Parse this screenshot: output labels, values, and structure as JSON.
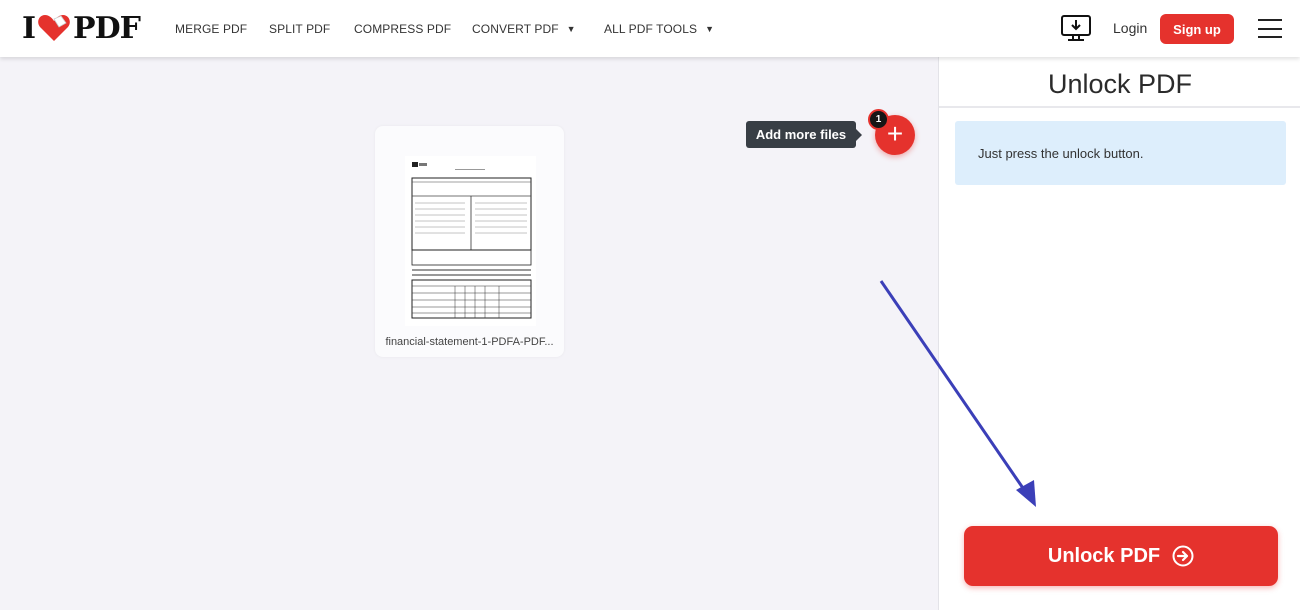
{
  "header": {
    "logo": {
      "left": "I",
      "right": "PDF"
    },
    "nav": [
      {
        "label": "MERGE PDF",
        "dropdown": false
      },
      {
        "label": "SPLIT PDF",
        "dropdown": false
      },
      {
        "label": "COMPRESS PDF",
        "dropdown": false
      },
      {
        "label": "CONVERT PDF",
        "dropdown": true
      },
      {
        "label": "ALL PDF TOOLS",
        "dropdown": true
      }
    ],
    "login_label": "Login",
    "signup_label": "Sign up",
    "icons": {
      "desktop": "desktop-download-icon",
      "menu": "hamburger-menu-icon"
    }
  },
  "workarea": {
    "file": {
      "name": "financial-statement-1-PDFA-PDF..."
    },
    "tooltip": "Add more files",
    "file_count": "1",
    "add_icon": "+"
  },
  "sidebar": {
    "title": "Unlock PDF",
    "info": "Just press the unlock button.",
    "action_label": "Unlock PDF",
    "action_icon": "arrow-right-circle-icon"
  },
  "colors": {
    "brand_red": "#e5322d",
    "info_bg": "#ddeefc",
    "annotation_arrow": "#3b3fb8"
  }
}
